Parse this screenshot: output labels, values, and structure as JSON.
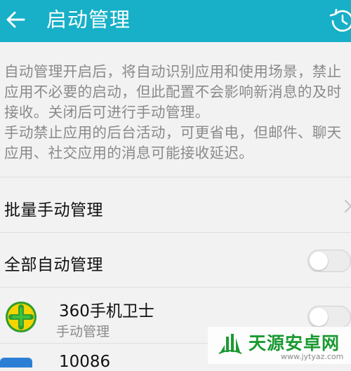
{
  "appbar": {
    "title": "启动管理",
    "back_icon": "arrow-left-icon",
    "history_icon": "history-clock-icon",
    "color": "#17b0c8"
  },
  "description": {
    "paragraph1": "自动管理开启后，将自动识别应用和使用场景，禁止应用不必要的启动，但此配置不会影响新消息的及时接收。关闭后可进行手动管理。",
    "paragraph2": "手动禁止应用的后台活动，可更省电，但邮件、聊天应用、社交应用的消息可能接收延迟。"
  },
  "batch_manual": {
    "label": "批量手动管理",
    "chevron_icon": "chevron-right-icon"
  },
  "auto_all": {
    "label": "全部自动管理",
    "enabled": false
  },
  "apps": [
    {
      "name": "360手机卫士",
      "status": "手动管理",
      "enabled": false,
      "icon": "360-security-icon"
    },
    {
      "name": "10086",
      "icon": "app-icon"
    }
  ],
  "watermark": {
    "title": "天源安卓网",
    "url": "www.jytyaz.com",
    "color": "#1a9a32"
  }
}
